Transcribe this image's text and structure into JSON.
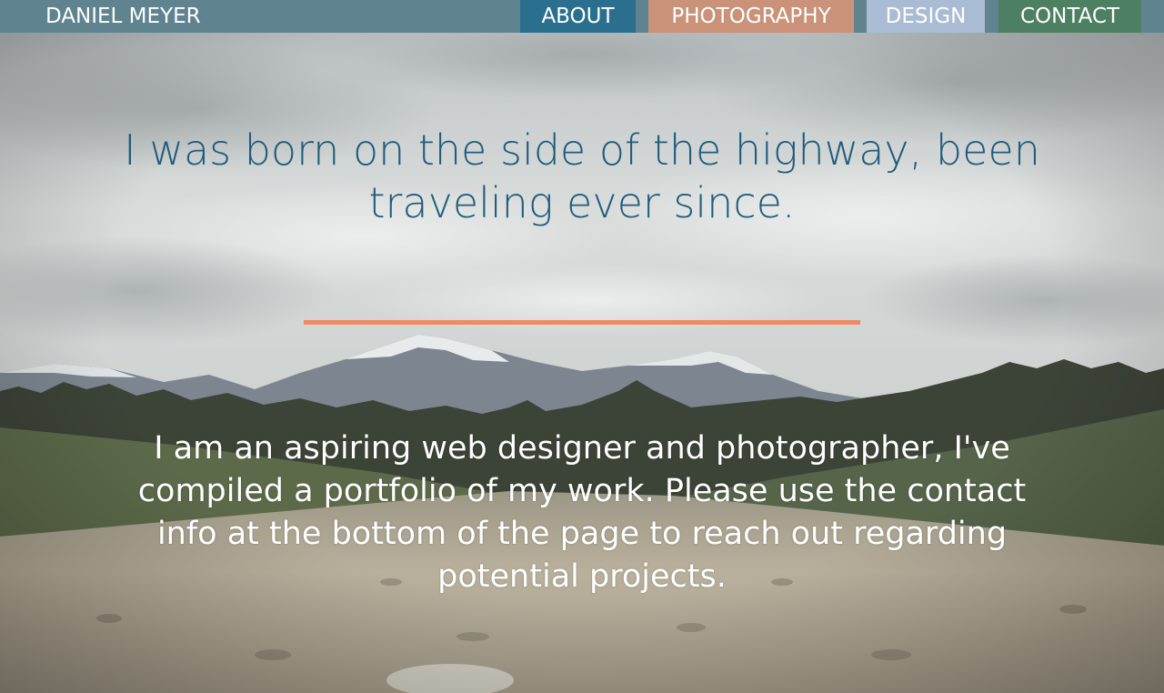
{
  "nav": {
    "brand": "DANIEL MEYER",
    "items": [
      {
        "label": "ABOUT",
        "color": "#2a6f8d"
      },
      {
        "label": "PHOTOGRAPHY",
        "color": "#c99279"
      },
      {
        "label": "DESIGN",
        "color": "#a9bcd4"
      },
      {
        "label": "CONTACT",
        "color": "#4d8062"
      }
    ]
  },
  "hero": {
    "headline": "I was born on the side of the highway, been traveling ever since.",
    "intro": "I am an aspiring web designer and photographer, I've compiled a portfolio of my work. Please use the contact info at the bottom of the page to reach out regarding potential projects."
  },
  "colors": {
    "navbar": "#5f8490",
    "headline": "#1f5c7d",
    "divider": "#ef8a62"
  }
}
